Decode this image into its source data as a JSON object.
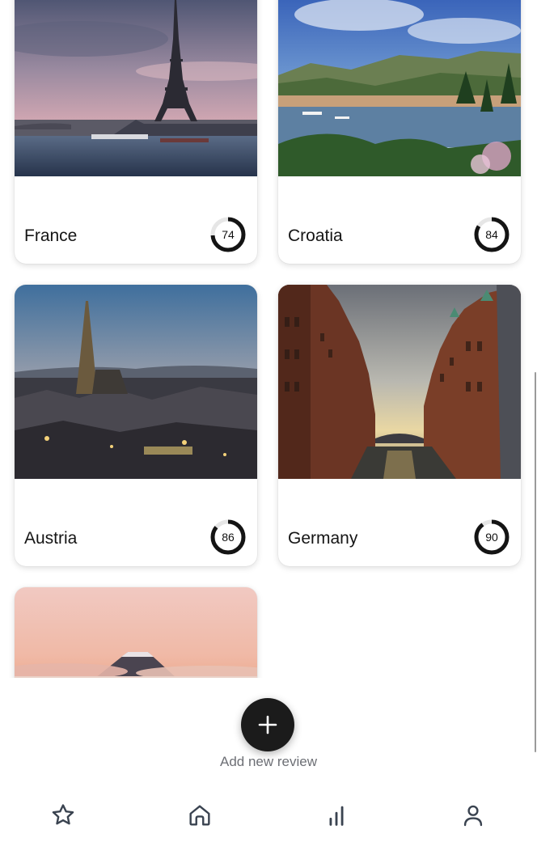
{
  "reviews": [
    {
      "country": "France",
      "score": 74,
      "score_fraction": 0.74,
      "photo": "eiffel-tower-paris"
    },
    {
      "country": "Croatia",
      "score": 84,
      "score_fraction": 0.84,
      "photo": "croatian-coastal-bay"
    },
    {
      "country": "Austria",
      "score": 86,
      "score_fraction": 0.86,
      "photo": "vienna-skyline-dusk"
    },
    {
      "country": "Germany",
      "score": 90,
      "score_fraction": 0.9,
      "photo": "hamburg-speicherstadt-canal"
    },
    {
      "country": "",
      "score": null,
      "photo": "mountain-above-clouds-sunset"
    }
  ],
  "fab": {
    "icon": "plus-icon",
    "label": "Add new review"
  },
  "nav": [
    {
      "id": "favorites",
      "icon": "star-icon"
    },
    {
      "id": "home",
      "icon": "home-icon"
    },
    {
      "id": "stats",
      "icon": "bar-chart-icon"
    },
    {
      "id": "profile",
      "icon": "user-icon"
    }
  ],
  "colors": {
    "ring": "#141414",
    "ring_track": "#e6e6e6",
    "fab": "#1b1b1b",
    "label": "#6d6f75",
    "icon": "#3a4350"
  }
}
